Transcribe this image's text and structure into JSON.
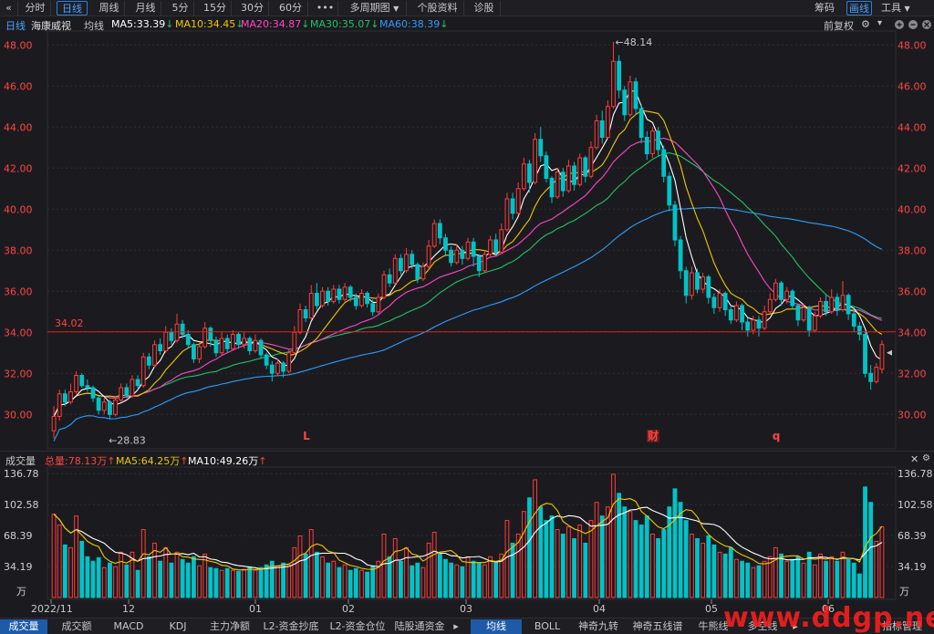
{
  "toolbar": {
    "back": "«",
    "tabs": [
      "分时",
      "日线",
      "周线",
      "月线",
      "5分",
      "15分",
      "30分",
      "60分"
    ],
    "more": "•••",
    "multi_period": "多周期图",
    "stock_info": "个股资料",
    "diagnose": "诊股",
    "right": [
      "筹码",
      "画线",
      "工具"
    ]
  },
  "info": {
    "period": "日线",
    "stock_name": "海康威视",
    "ma_type": "均线",
    "ma5": "MA5:33.39",
    "ma10": "MA10:34.45",
    "ma20": "MA20:34.87",
    "ma30": "MA30:35.07",
    "ma60": "MA60:38.39",
    "adjust": "前复权"
  },
  "colors": {
    "up": "#ff3b3b",
    "down": "#00c3c7",
    "ma5": "#ffffff",
    "ma10": "#f0c800",
    "ma20": "#ff46c8",
    "ma30": "#22c26a",
    "ma60": "#2e9cff",
    "axis_text": "#ff4444",
    "grid": "#2e2e34"
  },
  "price_axis": [
    "48.00",
    "46.00",
    "44.00",
    "42.00",
    "40.00",
    "38.00",
    "36.00",
    "34.00",
    "32.00",
    "30.00"
  ],
  "annotations": {
    "high": "48.14",
    "low": "28.83",
    "hline": "34.02",
    "markers": [
      "L",
      "财",
      "q"
    ]
  },
  "volume": {
    "title": "成交量",
    "total": "总量:78.13万",
    "ma5": "MA5:64.25万",
    "ma10": "MA10:49.26万",
    "axis": [
      "136.78",
      "102.58",
      "68.39",
      "34.19"
    ],
    "unit": "万"
  },
  "dates": [
    "2022/11",
    "12",
    "01",
    "02",
    "03",
    "04",
    "05",
    "06"
  ],
  "bottom_tabs": [
    "成交量",
    "成交额",
    "MACD",
    "KDJ",
    "主力净额",
    "L2-资金抄底",
    "L2-资金仓位",
    "陆股通资金"
  ],
  "bottom_tabs2": [
    "均线",
    "BOLL",
    "神奇九转",
    "神奇五线谱",
    "牛熊线",
    "多空线"
  ],
  "bottom_right": "指标管理",
  "watermark": "www.ddgp.net",
  "chart_data": {
    "type": "candlestick",
    "title": "海康威视 日线",
    "ylim": [
      28.5,
      48.5
    ],
    "price_ticks": [
      48,
      46,
      44,
      42,
      40,
      38,
      36,
      34,
      32,
      30
    ],
    "hline": 34.02,
    "high": 48.14,
    "low": 28.83,
    "ma_latest": {
      "MA5": 33.39,
      "MA10": 34.45,
      "MA20": 34.87,
      "MA30": 35.07,
      "MA60": 38.39
    },
    "volume_total": "78.13万",
    "volume_ma": {
      "MA5": "64.25万",
      "MA10": "49.26万"
    },
    "volume_ticks": [
      136.78,
      102.58,
      68.39,
      34.19
    ],
    "x_labels": [
      "2022/11",
      "12",
      "01",
      "02",
      "03",
      "04",
      "05",
      "06"
    ],
    "candles": [
      {
        "o": 29.2,
        "c": 29.9,
        "h": 30.4,
        "l": 28.83,
        "v": 92
      },
      {
        "o": 29.9,
        "c": 31.0,
        "h": 31.2,
        "l": 29.7,
        "v": 80
      },
      {
        "o": 31.0,
        "c": 30.6,
        "h": 31.2,
        "l": 30.4,
        "v": 58
      },
      {
        "o": 30.6,
        "c": 31.1,
        "h": 31.5,
        "l": 30.5,
        "v": 55
      },
      {
        "o": 31.1,
        "c": 31.9,
        "h": 32.1,
        "l": 31.0,
        "v": 90
      },
      {
        "o": 31.9,
        "c": 31.4,
        "h": 32.0,
        "l": 31.3,
        "v": 62
      },
      {
        "o": 31.4,
        "c": 31.3,
        "h": 31.7,
        "l": 31.1,
        "v": 45
      },
      {
        "o": 31.3,
        "c": 30.8,
        "h": 31.4,
        "l": 30.6,
        "v": 40
      },
      {
        "o": 30.8,
        "c": 30.2,
        "h": 30.9,
        "l": 30.0,
        "v": 44
      },
      {
        "o": 30.2,
        "c": 30.6,
        "h": 30.8,
        "l": 30.0,
        "v": 33
      },
      {
        "o": 30.6,
        "c": 30.0,
        "h": 30.7,
        "l": 29.8,
        "v": 38
      },
      {
        "o": 30.0,
        "c": 30.7,
        "h": 30.9,
        "l": 29.9,
        "v": 34
      },
      {
        "o": 30.7,
        "c": 31.3,
        "h": 31.5,
        "l": 30.6,
        "v": 50
      },
      {
        "o": 31.3,
        "c": 30.9,
        "h": 31.5,
        "l": 30.8,
        "v": 36
      },
      {
        "o": 30.9,
        "c": 31.7,
        "h": 31.9,
        "l": 30.8,
        "v": 50
      },
      {
        "o": 31.7,
        "c": 31.4,
        "h": 31.9,
        "l": 31.2,
        "v": 30
      },
      {
        "o": 31.4,
        "c": 32.8,
        "h": 33.0,
        "l": 31.3,
        "v": 75
      },
      {
        "o": 32.8,
        "c": 32.4,
        "h": 33.0,
        "l": 32.2,
        "v": 45
      },
      {
        "o": 32.4,
        "c": 33.4,
        "h": 33.6,
        "l": 32.3,
        "v": 60
      },
      {
        "o": 33.4,
        "c": 33.1,
        "h": 33.7,
        "l": 32.9,
        "v": 40
      },
      {
        "o": 33.1,
        "c": 34.0,
        "h": 34.3,
        "l": 33.0,
        "v": 55
      },
      {
        "o": 34.0,
        "c": 33.6,
        "h": 34.2,
        "l": 33.4,
        "v": 38
      },
      {
        "o": 33.6,
        "c": 34.4,
        "h": 34.9,
        "l": 33.5,
        "v": 50
      },
      {
        "o": 34.4,
        "c": 33.9,
        "h": 34.6,
        "l": 33.7,
        "v": 42
      },
      {
        "o": 33.9,
        "c": 33.4,
        "h": 34.1,
        "l": 33.2,
        "v": 38
      },
      {
        "o": 33.4,
        "c": 32.7,
        "h": 33.5,
        "l": 32.5,
        "v": 45
      },
      {
        "o": 32.7,
        "c": 33.3,
        "h": 33.5,
        "l": 32.5,
        "v": 35
      },
      {
        "o": 33.3,
        "c": 34.2,
        "h": 34.5,
        "l": 33.2,
        "v": 48
      },
      {
        "o": 34.2,
        "c": 33.6,
        "h": 34.3,
        "l": 33.3,
        "v": 33
      },
      {
        "o": 33.6,
        "c": 33.0,
        "h": 33.8,
        "l": 32.8,
        "v": 32
      },
      {
        "o": 33.0,
        "c": 33.7,
        "h": 34.0,
        "l": 32.9,
        "v": 30
      },
      {
        "o": 33.7,
        "c": 33.2,
        "h": 33.9,
        "l": 33.0,
        "v": 32
      },
      {
        "o": 33.2,
        "c": 33.9,
        "h": 34.1,
        "l": 33.1,
        "v": 30
      },
      {
        "o": 33.9,
        "c": 33.4,
        "h": 34.0,
        "l": 33.2,
        "v": 29
      },
      {
        "o": 33.4,
        "c": 33.7,
        "h": 34.0,
        "l": 33.2,
        "v": 31
      },
      {
        "o": 33.7,
        "c": 33.1,
        "h": 33.8,
        "l": 32.9,
        "v": 34
      },
      {
        "o": 33.1,
        "c": 33.6,
        "h": 33.9,
        "l": 33.0,
        "v": 30
      },
      {
        "o": 33.6,
        "c": 32.9,
        "h": 33.7,
        "l": 32.7,
        "v": 33
      },
      {
        "o": 32.9,
        "c": 32.4,
        "h": 33.0,
        "l": 32.2,
        "v": 36
      },
      {
        "o": 32.4,
        "c": 32.0,
        "h": 32.6,
        "l": 31.6,
        "v": 40
      },
      {
        "o": 32.0,
        "c": 32.5,
        "h": 32.7,
        "l": 31.9,
        "v": 35
      },
      {
        "o": 32.5,
        "c": 32.1,
        "h": 32.6,
        "l": 31.8,
        "v": 38
      },
      {
        "o": 32.1,
        "c": 33.0,
        "h": 33.2,
        "l": 32.0,
        "v": 36
      },
      {
        "o": 33.0,
        "c": 34.0,
        "h": 34.3,
        "l": 32.9,
        "v": 55
      },
      {
        "o": 34.0,
        "c": 35.1,
        "h": 35.4,
        "l": 33.9,
        "v": 68
      },
      {
        "o": 35.1,
        "c": 34.7,
        "h": 35.3,
        "l": 34.5,
        "v": 48
      },
      {
        "o": 34.7,
        "c": 35.9,
        "h": 36.3,
        "l": 34.6,
        "v": 75
      },
      {
        "o": 35.9,
        "c": 35.3,
        "h": 36.4,
        "l": 35.1,
        "v": 50
      },
      {
        "o": 35.3,
        "c": 36.0,
        "h": 36.2,
        "l": 35.2,
        "v": 45
      },
      {
        "o": 36.0,
        "c": 35.5,
        "h": 36.2,
        "l": 35.3,
        "v": 38
      },
      {
        "o": 35.5,
        "c": 36.1,
        "h": 36.3,
        "l": 35.4,
        "v": 40
      },
      {
        "o": 36.1,
        "c": 35.6,
        "h": 36.3,
        "l": 35.4,
        "v": 33
      },
      {
        "o": 35.6,
        "c": 36.2,
        "h": 36.4,
        "l": 35.5,
        "v": 36
      },
      {
        "o": 36.2,
        "c": 35.7,
        "h": 36.3,
        "l": 35.5,
        "v": 30
      },
      {
        "o": 35.7,
        "c": 35.3,
        "h": 35.9,
        "l": 35.1,
        "v": 32
      },
      {
        "o": 35.3,
        "c": 35.9,
        "h": 36.1,
        "l": 35.2,
        "v": 30
      },
      {
        "o": 35.9,
        "c": 35.4,
        "h": 36.0,
        "l": 35.2,
        "v": 28
      },
      {
        "o": 35.4,
        "c": 35.0,
        "h": 35.6,
        "l": 34.8,
        "v": 35
      },
      {
        "o": 35.0,
        "c": 35.7,
        "h": 35.9,
        "l": 34.9,
        "v": 40
      },
      {
        "o": 35.7,
        "c": 36.8,
        "h": 37.0,
        "l": 35.6,
        "v": 70
      },
      {
        "o": 36.8,
        "c": 36.4,
        "h": 37.1,
        "l": 36.2,
        "v": 45
      },
      {
        "o": 36.4,
        "c": 37.6,
        "h": 37.8,
        "l": 36.3,
        "v": 65
      },
      {
        "o": 37.6,
        "c": 37.0,
        "h": 37.8,
        "l": 36.8,
        "v": 40
      },
      {
        "o": 37.0,
        "c": 37.8,
        "h": 38.1,
        "l": 36.9,
        "v": 55
      },
      {
        "o": 37.8,
        "c": 37.3,
        "h": 38.0,
        "l": 37.1,
        "v": 35
      },
      {
        "o": 37.3,
        "c": 36.6,
        "h": 37.4,
        "l": 36.4,
        "v": 38
      },
      {
        "o": 36.6,
        "c": 37.2,
        "h": 37.4,
        "l": 36.5,
        "v": 33
      },
      {
        "o": 37.2,
        "c": 38.2,
        "h": 38.5,
        "l": 37.1,
        "v": 60
      },
      {
        "o": 38.2,
        "c": 39.3,
        "h": 39.5,
        "l": 38.1,
        "v": 72
      },
      {
        "o": 39.3,
        "c": 38.6,
        "h": 39.5,
        "l": 38.3,
        "v": 48
      },
      {
        "o": 38.6,
        "c": 38.0,
        "h": 38.8,
        "l": 37.7,
        "v": 42
      },
      {
        "o": 38.0,
        "c": 37.4,
        "h": 38.2,
        "l": 37.2,
        "v": 38
      },
      {
        "o": 37.4,
        "c": 38.0,
        "h": 38.3,
        "l": 37.3,
        "v": 36
      },
      {
        "o": 38.0,
        "c": 37.6,
        "h": 38.2,
        "l": 37.3,
        "v": 34
      },
      {
        "o": 37.6,
        "c": 38.4,
        "h": 38.6,
        "l": 37.5,
        "v": 45
      },
      {
        "o": 38.4,
        "c": 37.7,
        "h": 38.6,
        "l": 37.2,
        "v": 40
      },
      {
        "o": 37.7,
        "c": 37.0,
        "h": 37.8,
        "l": 36.7,
        "v": 38
      },
      {
        "o": 37.0,
        "c": 37.8,
        "h": 38.0,
        "l": 36.9,
        "v": 36
      },
      {
        "o": 37.8,
        "c": 38.5,
        "h": 38.7,
        "l": 37.7,
        "v": 45
      },
      {
        "o": 38.5,
        "c": 37.9,
        "h": 38.8,
        "l": 37.7,
        "v": 40
      },
      {
        "o": 37.9,
        "c": 39.0,
        "h": 39.3,
        "l": 37.8,
        "v": 48
      },
      {
        "o": 39.0,
        "c": 40.5,
        "h": 40.8,
        "l": 38.9,
        "v": 85
      },
      {
        "o": 40.5,
        "c": 39.8,
        "h": 40.8,
        "l": 39.5,
        "v": 60
      },
      {
        "o": 39.8,
        "c": 41.0,
        "h": 41.3,
        "l": 39.7,
        "v": 70
      },
      {
        "o": 41.0,
        "c": 42.2,
        "h": 42.5,
        "l": 40.9,
        "v": 95
      },
      {
        "o": 42.2,
        "c": 41.3,
        "h": 42.4,
        "l": 40.8,
        "v": 110
      },
      {
        "o": 41.3,
        "c": 43.4,
        "h": 43.7,
        "l": 41.2,
        "v": 130
      },
      {
        "o": 43.4,
        "c": 42.6,
        "h": 44.0,
        "l": 42.3,
        "v": 100
      },
      {
        "o": 42.6,
        "c": 41.5,
        "h": 42.8,
        "l": 41.3,
        "v": 85
      },
      {
        "o": 41.5,
        "c": 40.6,
        "h": 41.6,
        "l": 40.3,
        "v": 90
      },
      {
        "o": 40.6,
        "c": 41.8,
        "h": 42.0,
        "l": 40.5,
        "v": 75
      },
      {
        "o": 41.8,
        "c": 40.9,
        "h": 42.0,
        "l": 40.6,
        "v": 70
      },
      {
        "o": 40.9,
        "c": 42.1,
        "h": 42.4,
        "l": 40.8,
        "v": 78
      },
      {
        "o": 42.1,
        "c": 41.2,
        "h": 42.3,
        "l": 40.9,
        "v": 65
      },
      {
        "o": 41.2,
        "c": 42.5,
        "h": 42.7,
        "l": 41.1,
        "v": 80
      },
      {
        "o": 42.5,
        "c": 41.6,
        "h": 42.6,
        "l": 41.3,
        "v": 60
      },
      {
        "o": 41.6,
        "c": 43.0,
        "h": 43.3,
        "l": 41.5,
        "v": 85
      },
      {
        "o": 43.0,
        "c": 44.3,
        "h": 44.6,
        "l": 42.9,
        "v": 105
      },
      {
        "o": 44.3,
        "c": 43.5,
        "h": 44.8,
        "l": 43.2,
        "v": 90
      },
      {
        "o": 43.5,
        "c": 45.0,
        "h": 45.3,
        "l": 43.4,
        "v": 100
      },
      {
        "o": 45.0,
        "c": 47.2,
        "h": 48.14,
        "l": 44.9,
        "v": 136
      },
      {
        "o": 47.2,
        "c": 45.8,
        "h": 47.5,
        "l": 45.4,
        "v": 115
      },
      {
        "o": 45.8,
        "c": 44.6,
        "h": 46.0,
        "l": 44.3,
        "v": 100
      },
      {
        "o": 44.6,
        "c": 46.2,
        "h": 46.5,
        "l": 44.5,
        "v": 95
      },
      {
        "o": 46.2,
        "c": 44.9,
        "h": 46.4,
        "l": 44.6,
        "v": 85
      },
      {
        "o": 44.9,
        "c": 43.5,
        "h": 45.1,
        "l": 43.2,
        "v": 80
      },
      {
        "o": 43.5,
        "c": 42.7,
        "h": 43.8,
        "l": 42.4,
        "v": 90
      },
      {
        "o": 42.7,
        "c": 43.8,
        "h": 44.0,
        "l": 42.5,
        "v": 70
      },
      {
        "o": 43.8,
        "c": 42.9,
        "h": 44.0,
        "l": 42.6,
        "v": 65
      },
      {
        "o": 42.9,
        "c": 41.6,
        "h": 43.1,
        "l": 41.3,
        "v": 75
      },
      {
        "o": 41.6,
        "c": 40.2,
        "h": 41.8,
        "l": 39.9,
        "v": 100
      },
      {
        "o": 40.2,
        "c": 38.5,
        "h": 40.4,
        "l": 38.2,
        "v": 120
      },
      {
        "o": 38.5,
        "c": 37.0,
        "h": 38.7,
        "l": 36.6,
        "v": 105
      },
      {
        "o": 37.0,
        "c": 35.8,
        "h": 37.2,
        "l": 35.4,
        "v": 85
      },
      {
        "o": 35.8,
        "c": 36.9,
        "h": 37.2,
        "l": 35.6,
        "v": 70
      },
      {
        "o": 36.9,
        "c": 36.1,
        "h": 37.1,
        "l": 35.9,
        "v": 65
      },
      {
        "o": 36.1,
        "c": 36.7,
        "h": 36.9,
        "l": 35.9,
        "v": 60
      },
      {
        "o": 36.7,
        "c": 35.7,
        "h": 36.8,
        "l": 35.4,
        "v": 68
      },
      {
        "o": 35.7,
        "c": 35.2,
        "h": 35.9,
        "l": 34.9,
        "v": 58
      },
      {
        "o": 35.2,
        "c": 35.9,
        "h": 36.1,
        "l": 35.0,
        "v": 50
      },
      {
        "o": 35.9,
        "c": 35.1,
        "h": 36.0,
        "l": 34.8,
        "v": 48
      },
      {
        "o": 35.1,
        "c": 34.6,
        "h": 35.3,
        "l": 34.4,
        "v": 55
      },
      {
        "o": 34.6,
        "c": 35.3,
        "h": 35.5,
        "l": 34.5,
        "v": 42
      },
      {
        "o": 35.3,
        "c": 34.5,
        "h": 35.4,
        "l": 34.1,
        "v": 40
      },
      {
        "o": 34.5,
        "c": 34.1,
        "h": 34.7,
        "l": 33.8,
        "v": 38
      },
      {
        "o": 34.1,
        "c": 34.6,
        "h": 34.8,
        "l": 33.9,
        "v": 33
      },
      {
        "o": 34.6,
        "c": 34.2,
        "h": 34.8,
        "l": 33.8,
        "v": 35
      },
      {
        "o": 34.2,
        "c": 35.0,
        "h": 35.3,
        "l": 34.1,
        "v": 40
      },
      {
        "o": 35.0,
        "c": 35.6,
        "h": 35.9,
        "l": 34.9,
        "v": 45
      },
      {
        "o": 35.6,
        "c": 36.4,
        "h": 36.6,
        "l": 35.5,
        "v": 55
      },
      {
        "o": 36.4,
        "c": 35.6,
        "h": 36.5,
        "l": 35.3,
        "v": 48
      },
      {
        "o": 35.6,
        "c": 36.0,
        "h": 36.2,
        "l": 35.4,
        "v": 40
      },
      {
        "o": 36.0,
        "c": 35.3,
        "h": 36.1,
        "l": 35.1,
        "v": 42
      },
      {
        "o": 35.3,
        "c": 34.6,
        "h": 35.4,
        "l": 34.3,
        "v": 45
      },
      {
        "o": 34.6,
        "c": 35.2,
        "h": 35.4,
        "l": 34.5,
        "v": 38
      },
      {
        "o": 35.2,
        "c": 34.1,
        "h": 35.3,
        "l": 33.8,
        "v": 50
      },
      {
        "o": 34.1,
        "c": 34.8,
        "h": 35.0,
        "l": 34.0,
        "v": 36
      },
      {
        "o": 34.8,
        "c": 35.5,
        "h": 35.7,
        "l": 34.7,
        "v": 48
      },
      {
        "o": 35.5,
        "c": 35.0,
        "h": 35.8,
        "l": 34.8,
        "v": 40
      },
      {
        "o": 35.0,
        "c": 35.7,
        "h": 36.1,
        "l": 34.9,
        "v": 45
      },
      {
        "o": 35.7,
        "c": 35.1,
        "h": 35.9,
        "l": 34.8,
        "v": 40
      },
      {
        "o": 35.1,
        "c": 35.8,
        "h": 36.5,
        "l": 35.0,
        "v": 50
      },
      {
        "o": 35.8,
        "c": 34.9,
        "h": 35.9,
        "l": 34.6,
        "v": 42
      },
      {
        "o": 34.9,
        "c": 34.3,
        "h": 35.1,
        "l": 34.0,
        "v": 38
      },
      {
        "o": 34.3,
        "c": 33.9,
        "h": 34.5,
        "l": 33.6,
        "v": 26
      },
      {
        "o": 33.9,
        "c": 32.0,
        "h": 34.0,
        "l": 31.8,
        "v": 122
      },
      {
        "o": 32.0,
        "c": 31.6,
        "h": 32.4,
        "l": 31.2,
        "v": 105
      },
      {
        "o": 31.6,
        "c": 32.3,
        "h": 32.5,
        "l": 31.5,
        "v": 62
      },
      {
        "o": 32.2,
        "c": 33.4,
        "h": 33.6,
        "l": 32.0,
        "v": 78
      }
    ]
  }
}
